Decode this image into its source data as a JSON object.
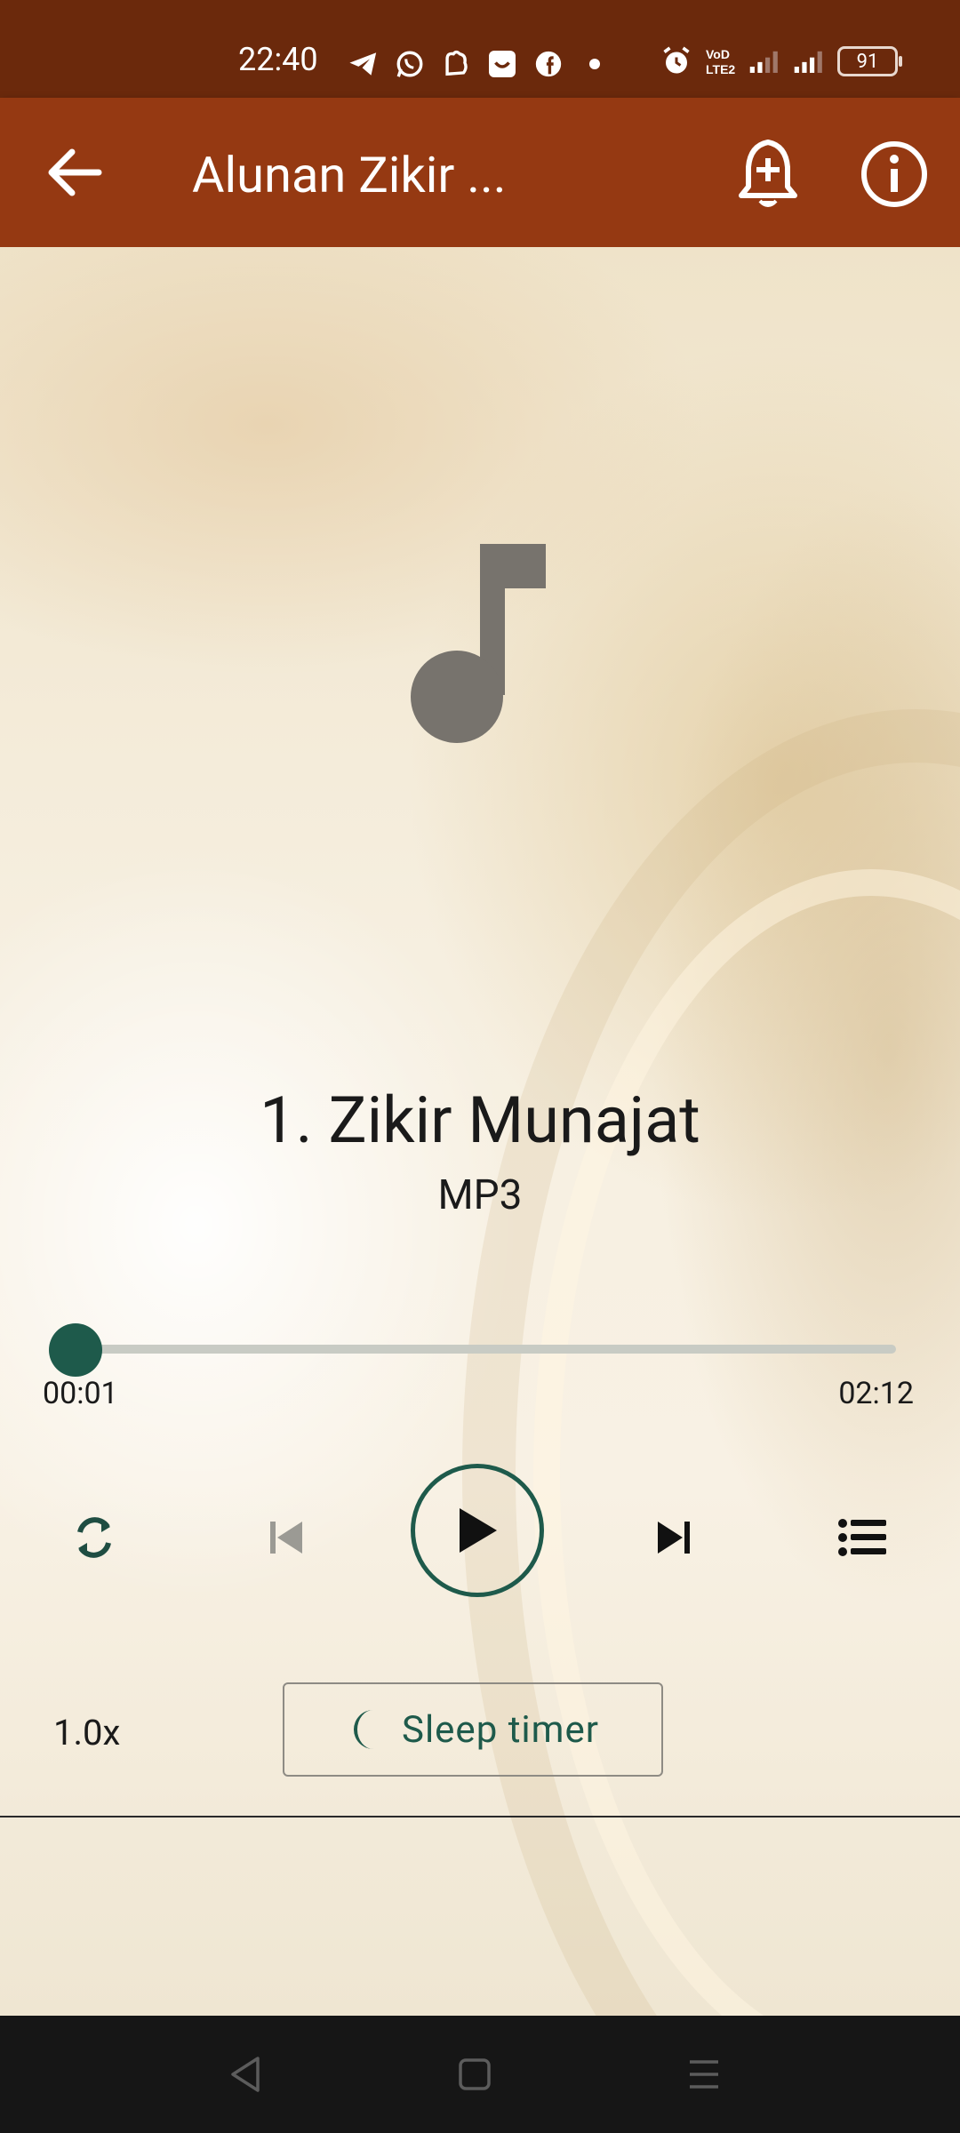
{
  "status_bar": {
    "time": "22:40",
    "battery": "91",
    "icons": [
      "telegram-icon",
      "whatsapp-icon",
      "cloud-app-icon",
      "shopee-icon",
      "facebook-icon",
      "dot-icon",
      "alarm-icon",
      "volte-icon",
      "signal-icon",
      "signal-icon"
    ]
  },
  "app_bar": {
    "title": "Alunan Zikir ...",
    "back_icon": "arrow-back-icon",
    "bell_icon": "bell-add-icon",
    "info_icon": "info-icon",
    "color": "#953912"
  },
  "player": {
    "track_title": "1. Zikir Munajat",
    "track_format": "MP3",
    "current_time": "00:01",
    "total_time": "02:12",
    "progress_fraction": 0.008,
    "accent_color": "#1e5a4b"
  },
  "controls": {
    "repeat_icon": "repeat-icon",
    "previous_icon": "skip-previous-icon",
    "play_icon": "play-icon",
    "next_icon": "skip-next-icon",
    "queue_icon": "playlist-icon"
  },
  "bottom": {
    "speed": "1.0x",
    "sleep_timer_label": "Sleep timer",
    "sleep_icon": "moon-icon"
  },
  "nav_bar": {
    "back": "nav-back-icon",
    "home": "nav-home-icon",
    "recents": "nav-menu-icon"
  }
}
